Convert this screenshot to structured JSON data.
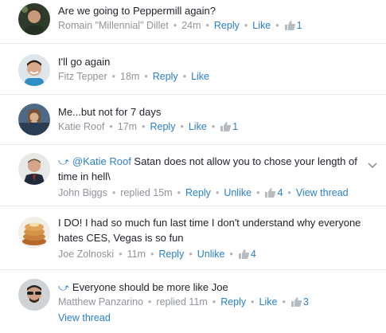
{
  "comments": [
    {
      "text": "Are we going to Peppermill again?",
      "author": "Romain \"Millennial\" Dillet",
      "time": "24m",
      "reply": "Reply",
      "like": "Like",
      "like_count": "1"
    },
    {
      "text": "I'll go again",
      "author": "Fitz Tepper",
      "time": "18m",
      "reply": "Reply",
      "like": "Like"
    },
    {
      "text": "Me...but not for 7 days",
      "author": "Katie Roof",
      "time": "17m",
      "reply": "Reply",
      "like": "Like",
      "like_count": "1"
    },
    {
      "mention": "@Katie Roof",
      "text": " Satan does not allow you to chose your length of time in hell\\",
      "author": "John Biggs",
      "time": "replied 15m",
      "reply": "Reply",
      "like": "Unlike",
      "like_count": "4",
      "view_thread": "View thread"
    },
    {
      "text": "I DO! I had so much fun last time I don't understand why everyone hates CES, Vegas is so fun",
      "author": "Joe Zolnoski",
      "time": "11m",
      "reply": "Reply",
      "like": "Unlike",
      "like_count": "4"
    },
    {
      "text": "Everyone should be more like Joe",
      "author": "Matthew Panzarino",
      "time": "replied 11m",
      "reply": "Reply",
      "like": "Like",
      "like_count": "3",
      "view_thread": "View thread"
    }
  ],
  "colors": {
    "link": "#2a7fc9",
    "meta": "#90949c",
    "text": "#1d2129",
    "divider": "#e3e6ea"
  },
  "icons": {
    "thumb": "thumbs-up-icon",
    "reply": "reply-arrow-icon",
    "menu": "chevron-down-icon"
  }
}
